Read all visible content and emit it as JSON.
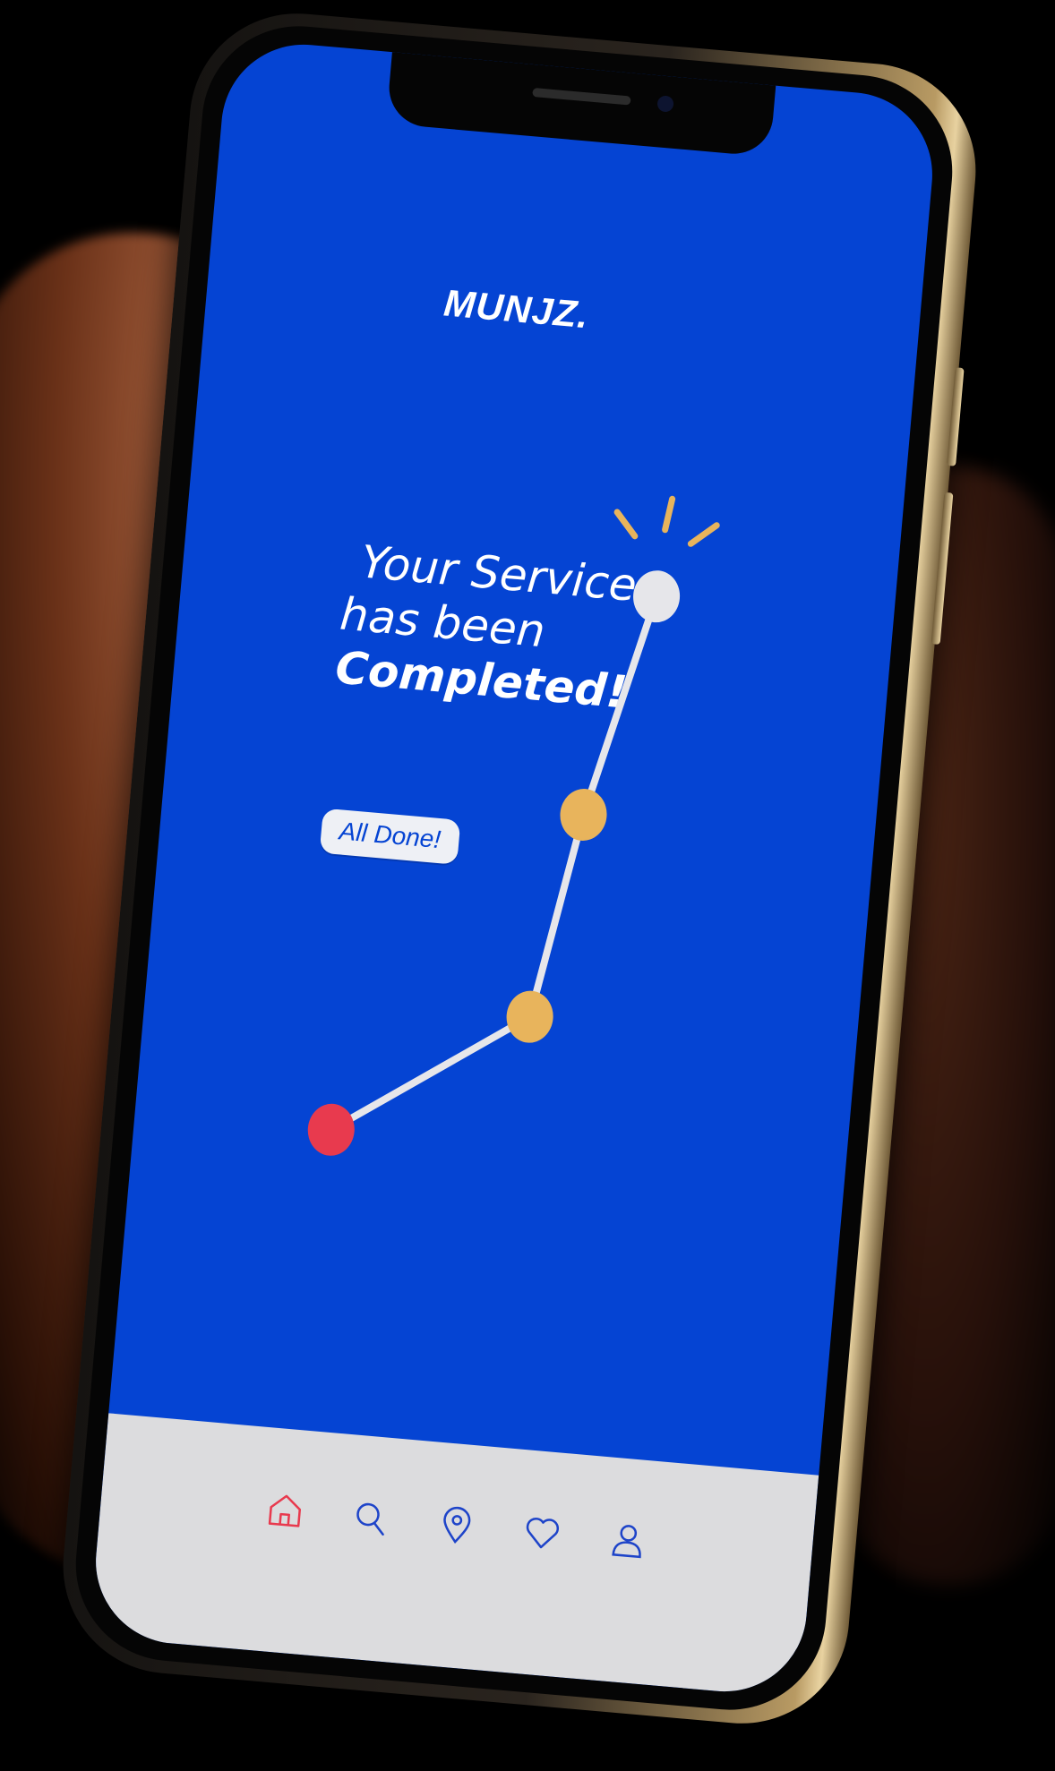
{
  "app": {
    "logo_text": "MUNJZ."
  },
  "status": {
    "line1": "Your Service",
    "line2": "has been",
    "line3": "Completed!"
  },
  "actions": {
    "done_label": "All Done!"
  },
  "progress": {
    "steps": [
      {
        "state": "start",
        "color": "#e83a4e"
      },
      {
        "state": "in-progress",
        "color": "#e8b45c"
      },
      {
        "state": "in-progress",
        "color": "#e8b45c"
      },
      {
        "state": "completed",
        "color": "#e6e6ea"
      }
    ],
    "line_color": "#e6e6ea",
    "spark_color": "#e8b45c"
  },
  "tabbar": {
    "items": [
      {
        "name": "home",
        "icon": "home-icon",
        "active": true
      },
      {
        "name": "search",
        "icon": "search-icon",
        "active": false
      },
      {
        "name": "location",
        "icon": "location-pin-icon",
        "active": false
      },
      {
        "name": "favorites",
        "icon": "heart-icon",
        "active": false
      },
      {
        "name": "profile",
        "icon": "user-icon",
        "active": false
      }
    ],
    "active_color": "#e83a4e",
    "inactive_color": "#1e44c9"
  },
  "colors": {
    "screen_bg": "#0544d3",
    "tabbar_bg": "#dcdcde"
  }
}
